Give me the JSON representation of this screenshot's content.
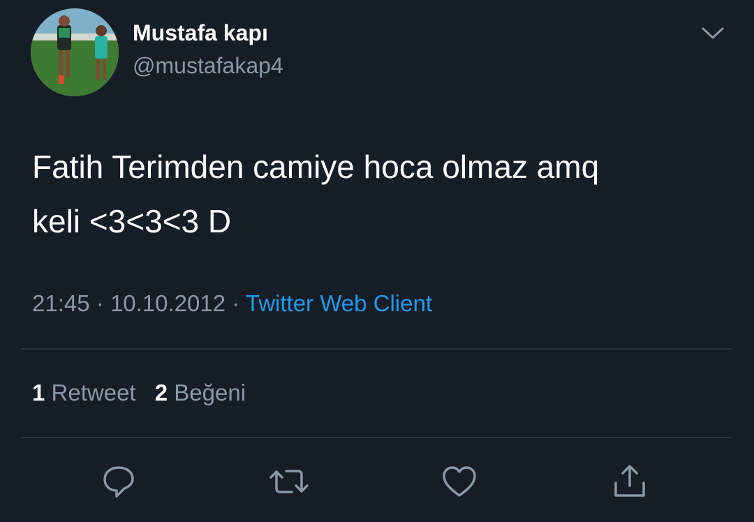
{
  "tweet": {
    "author": {
      "display_name": "Mustafa kapı",
      "handle": "@mustafakap4",
      "avatar_icon": "avatar-photo"
    },
    "text": "Fatih Terimden camiye hoca olmaz amq\nkeli <3<3<3 D",
    "meta": {
      "time": "21:45",
      "separator": "·",
      "date": "10.10.2012",
      "source": "Twitter Web Client"
    },
    "stats": {
      "retweet_count": "1",
      "retweet_label": "Retweet",
      "like_count": "2",
      "like_label": "Beğeni"
    },
    "actions": {
      "reply_icon": "reply-icon",
      "retweet_icon": "retweet-icon",
      "like_icon": "heart-icon",
      "share_icon": "share-icon"
    },
    "menu_icon": "chevron-down-icon"
  },
  "colors": {
    "background": "#151d26",
    "primary_text": "#ffffff",
    "secondary_text": "#8899a6",
    "link": "#1d9bf0",
    "divider": "#2a3440"
  }
}
